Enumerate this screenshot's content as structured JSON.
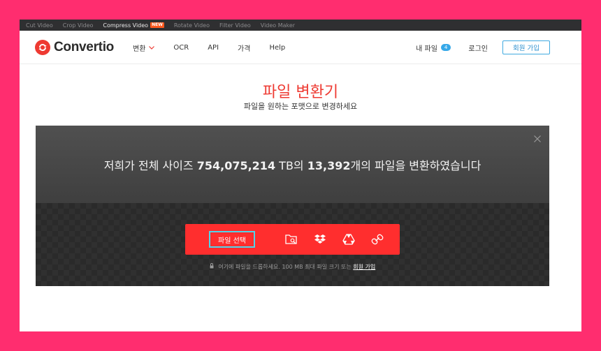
{
  "top_strip": {
    "links": [
      "Cut Video",
      "Crop Video",
      "Compress Video",
      "Rotate Video",
      "Filter Video",
      "Video Maker"
    ],
    "new_badge": "NEW"
  },
  "navbar": {
    "logo_text": "Convertio",
    "menu": [
      "변환",
      "OCR",
      "API",
      "가격",
      "Help"
    ],
    "my_files_label": "내 파일",
    "my_files_count": "4",
    "login_label": "로그인",
    "signup_label": "회원 가입"
  },
  "hero": {
    "title": "파일 변환기",
    "subtitle": "파일을 원하는 포맷으로 변경하세요"
  },
  "stats": {
    "prefix": "저희가 전체 사이즈 ",
    "size_value": "754,075,214",
    "size_unit": " TB의 ",
    "file_count": "13,392",
    "suffix": "개의 파일을 변환하였습니다"
  },
  "upload": {
    "choose_label": "파일 선택",
    "sources": [
      "folder-search-icon",
      "dropbox-icon",
      "google-drive-icon",
      "url-link-icon"
    ],
    "hint": "여기에 파일을 드롭하세요. 100 MB 최대 파일 크기 또는 ",
    "hint_link": "회원 가입"
  },
  "colors": {
    "accent_red": "#ee3a32",
    "upload_red": "#ff2e2e",
    "frame_pink": "#ff2d6f",
    "focus_cyan": "#51d4ea",
    "link_blue": "#3fa9e0"
  }
}
